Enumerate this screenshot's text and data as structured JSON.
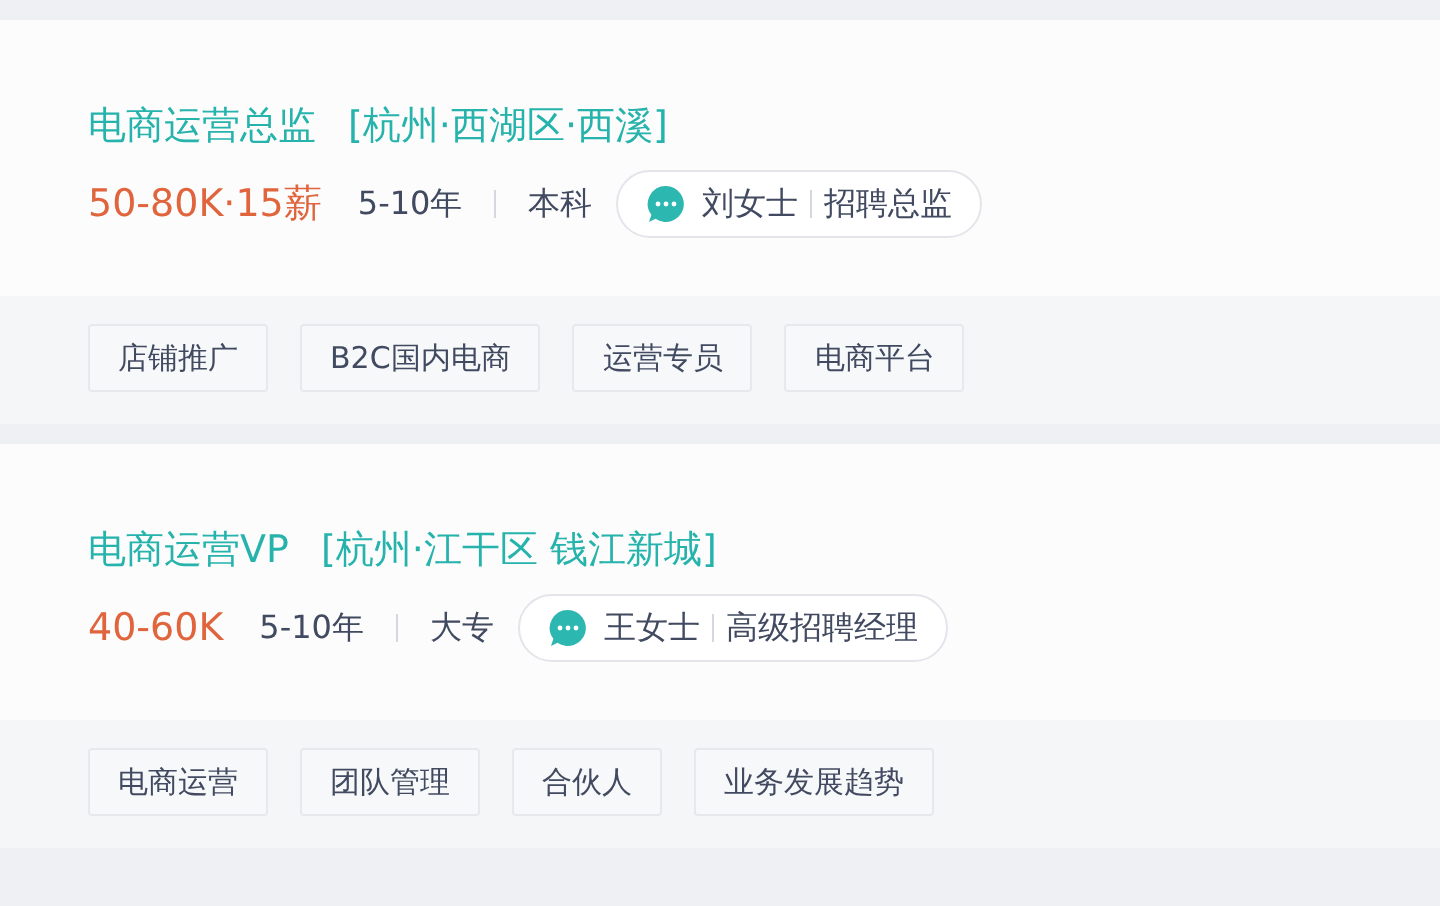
{
  "jobs": [
    {
      "title": "电商运营总监",
      "location": "[杭州·西湖区·西溪]",
      "salary": "50-80K·15薪",
      "experience": "5-10年",
      "education": "本科",
      "contact": {
        "name": "刘女士",
        "role": "招聘总监"
      },
      "tags": [
        "店铺推广",
        "B2C国内电商",
        "运营专员",
        "电商平台"
      ]
    },
    {
      "title": "电商运营VP",
      "location": "[杭州·江干区 钱江新城]",
      "salary": "40-60K",
      "experience": "5-10年",
      "education": "大专",
      "contact": {
        "name": "王女士",
        "role": "高级招聘经理"
      },
      "tags": [
        "电商运营",
        "团队管理",
        "合伙人",
        "业务发展趋势"
      ]
    }
  ]
}
